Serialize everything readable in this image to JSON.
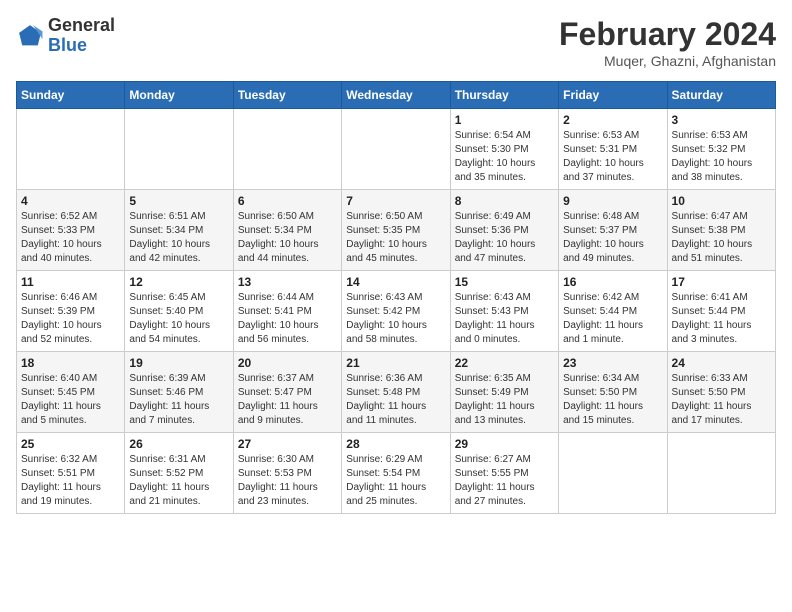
{
  "header": {
    "logo_line1": "General",
    "logo_line2": "Blue",
    "month_year": "February 2024",
    "location": "Muqer, Ghazni, Afghanistan"
  },
  "weekdays": [
    "Sunday",
    "Monday",
    "Tuesday",
    "Wednesday",
    "Thursday",
    "Friday",
    "Saturday"
  ],
  "weeks": [
    [
      {
        "day": "",
        "info": ""
      },
      {
        "day": "",
        "info": ""
      },
      {
        "day": "",
        "info": ""
      },
      {
        "day": "",
        "info": ""
      },
      {
        "day": "1",
        "info": "Sunrise: 6:54 AM\nSunset: 5:30 PM\nDaylight: 10 hours\nand 35 minutes."
      },
      {
        "day": "2",
        "info": "Sunrise: 6:53 AM\nSunset: 5:31 PM\nDaylight: 10 hours\nand 37 minutes."
      },
      {
        "day": "3",
        "info": "Sunrise: 6:53 AM\nSunset: 5:32 PM\nDaylight: 10 hours\nand 38 minutes."
      }
    ],
    [
      {
        "day": "4",
        "info": "Sunrise: 6:52 AM\nSunset: 5:33 PM\nDaylight: 10 hours\nand 40 minutes."
      },
      {
        "day": "5",
        "info": "Sunrise: 6:51 AM\nSunset: 5:34 PM\nDaylight: 10 hours\nand 42 minutes."
      },
      {
        "day": "6",
        "info": "Sunrise: 6:50 AM\nSunset: 5:34 PM\nDaylight: 10 hours\nand 44 minutes."
      },
      {
        "day": "7",
        "info": "Sunrise: 6:50 AM\nSunset: 5:35 PM\nDaylight: 10 hours\nand 45 minutes."
      },
      {
        "day": "8",
        "info": "Sunrise: 6:49 AM\nSunset: 5:36 PM\nDaylight: 10 hours\nand 47 minutes."
      },
      {
        "day": "9",
        "info": "Sunrise: 6:48 AM\nSunset: 5:37 PM\nDaylight: 10 hours\nand 49 minutes."
      },
      {
        "day": "10",
        "info": "Sunrise: 6:47 AM\nSunset: 5:38 PM\nDaylight: 10 hours\nand 51 minutes."
      }
    ],
    [
      {
        "day": "11",
        "info": "Sunrise: 6:46 AM\nSunset: 5:39 PM\nDaylight: 10 hours\nand 52 minutes."
      },
      {
        "day": "12",
        "info": "Sunrise: 6:45 AM\nSunset: 5:40 PM\nDaylight: 10 hours\nand 54 minutes."
      },
      {
        "day": "13",
        "info": "Sunrise: 6:44 AM\nSunset: 5:41 PM\nDaylight: 10 hours\nand 56 minutes."
      },
      {
        "day": "14",
        "info": "Sunrise: 6:43 AM\nSunset: 5:42 PM\nDaylight: 10 hours\nand 58 minutes."
      },
      {
        "day": "15",
        "info": "Sunrise: 6:43 AM\nSunset: 5:43 PM\nDaylight: 11 hours\nand 0 minutes."
      },
      {
        "day": "16",
        "info": "Sunrise: 6:42 AM\nSunset: 5:44 PM\nDaylight: 11 hours\nand 1 minute."
      },
      {
        "day": "17",
        "info": "Sunrise: 6:41 AM\nSunset: 5:44 PM\nDaylight: 11 hours\nand 3 minutes."
      }
    ],
    [
      {
        "day": "18",
        "info": "Sunrise: 6:40 AM\nSunset: 5:45 PM\nDaylight: 11 hours\nand 5 minutes."
      },
      {
        "day": "19",
        "info": "Sunrise: 6:39 AM\nSunset: 5:46 PM\nDaylight: 11 hours\nand 7 minutes."
      },
      {
        "day": "20",
        "info": "Sunrise: 6:37 AM\nSunset: 5:47 PM\nDaylight: 11 hours\nand 9 minutes."
      },
      {
        "day": "21",
        "info": "Sunrise: 6:36 AM\nSunset: 5:48 PM\nDaylight: 11 hours\nand 11 minutes."
      },
      {
        "day": "22",
        "info": "Sunrise: 6:35 AM\nSunset: 5:49 PM\nDaylight: 11 hours\nand 13 minutes."
      },
      {
        "day": "23",
        "info": "Sunrise: 6:34 AM\nSunset: 5:50 PM\nDaylight: 11 hours\nand 15 minutes."
      },
      {
        "day": "24",
        "info": "Sunrise: 6:33 AM\nSunset: 5:50 PM\nDaylight: 11 hours\nand 17 minutes."
      }
    ],
    [
      {
        "day": "25",
        "info": "Sunrise: 6:32 AM\nSunset: 5:51 PM\nDaylight: 11 hours\nand 19 minutes."
      },
      {
        "day": "26",
        "info": "Sunrise: 6:31 AM\nSunset: 5:52 PM\nDaylight: 11 hours\nand 21 minutes."
      },
      {
        "day": "27",
        "info": "Sunrise: 6:30 AM\nSunset: 5:53 PM\nDaylight: 11 hours\nand 23 minutes."
      },
      {
        "day": "28",
        "info": "Sunrise: 6:29 AM\nSunset: 5:54 PM\nDaylight: 11 hours\nand 25 minutes."
      },
      {
        "day": "29",
        "info": "Sunrise: 6:27 AM\nSunset: 5:55 PM\nDaylight: 11 hours\nand 27 minutes."
      },
      {
        "day": "",
        "info": ""
      },
      {
        "day": "",
        "info": ""
      }
    ]
  ]
}
